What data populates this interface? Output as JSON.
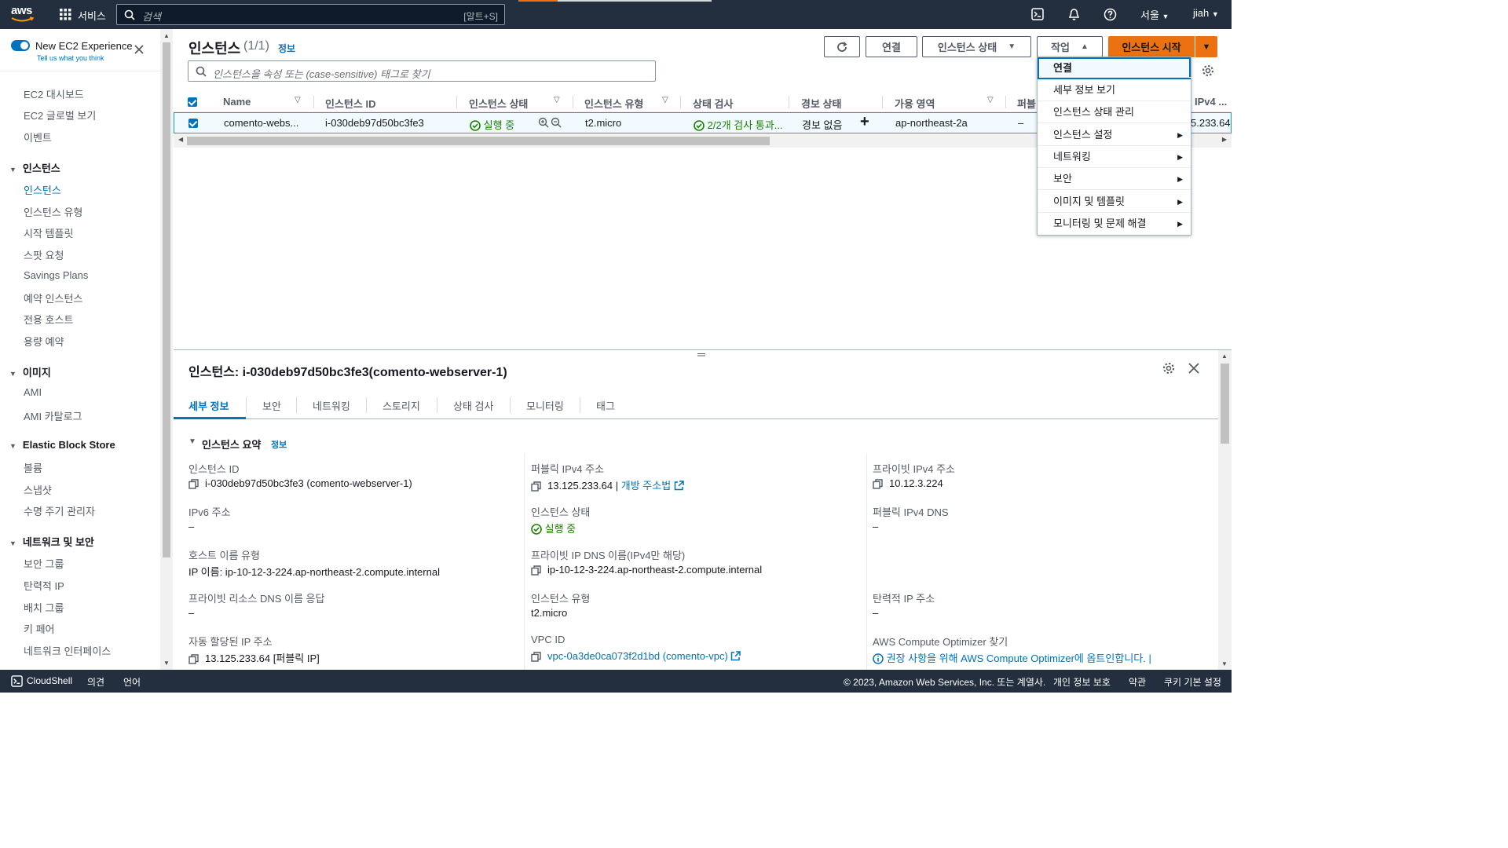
{
  "topnav": {
    "logo": "aws",
    "services": "서비스",
    "search_placeholder": "검색",
    "search_shortcut": "[알트+S]",
    "region": "서울",
    "user": "jiah",
    "icons": [
      "cloudshell-icon",
      "bell-icon",
      "help-icon"
    ]
  },
  "sidebar": {
    "experience_title": "New EC2 Experience",
    "experience_sub": "Tell us what you think",
    "top_items": [
      "EC2 대시보드",
      "EC2 글로벌 보기",
      "이벤트"
    ],
    "sections": [
      {
        "title": "인스턴스",
        "items": [
          "인스턴스",
          "인스턴스 유형",
          "시작 템플릿",
          "스팟 요청",
          "Savings Plans",
          "예약 인스턴스",
          "전용 호스트",
          "용량 예약"
        ]
      },
      {
        "title": "이미지",
        "items": [
          "AMI",
          "AMI 카탈로그"
        ]
      },
      {
        "title": "Elastic Block Store",
        "items": [
          "볼륨",
          "스냅샷",
          "수명 주기 관리자"
        ]
      },
      {
        "title": "네트워크 및 보안",
        "items": [
          "보안 그룹",
          "탄력적 IP",
          "배치 그룹",
          "키 페어",
          "네트워크 인터페이스"
        ]
      }
    ]
  },
  "header": {
    "title": "인스턴스",
    "count": "(1/1)",
    "info": "정보",
    "buttons": {
      "connect": "연결",
      "instance_state": "인스턴스 상태",
      "actions": "작업",
      "launch": "인스턴스 시작"
    },
    "filter_placeholder": "인스턴스을 속성 또는 (case-sensitive) 태그로 찾기"
  },
  "table": {
    "columns": [
      "Name",
      "인스턴스 ID",
      "인스턴스 상태",
      "인스턴스 유형",
      "상태 검사",
      "경보 상태",
      "가용 영역",
      "퍼블",
      "IPv4 ..."
    ],
    "row": {
      "name": "comento-webs...",
      "id": "i-030deb97d50bc3fe3",
      "state": "실행 중",
      "type": "t2.micro",
      "check": "2/2개 검사 통과...",
      "alarm": "경보 없음",
      "add": "+",
      "az": "ap-northeast-2a",
      "public": "–",
      "ipv4": "5.233.64"
    }
  },
  "menu": [
    {
      "label": "연결",
      "sub": false
    },
    {
      "label": "세부 정보 보기",
      "sub": false
    },
    {
      "label": "인스턴스 상태 관리",
      "sub": false
    },
    {
      "label": "인스턴스 설정",
      "sub": true
    },
    {
      "label": "네트워킹",
      "sub": true
    },
    {
      "label": "보안",
      "sub": true
    },
    {
      "label": "이미지 및 템플릿",
      "sub": true
    },
    {
      "label": "모니터링 및 문제 해결",
      "sub": true
    }
  ],
  "detail": {
    "title": "인스턴스: i-030deb97d50bc3fe3(comento-webserver-1)",
    "tabs": [
      "세부 정보",
      "보안",
      "네트워킹",
      "스토리지",
      "상태 검사",
      "모니터링",
      "태그"
    ],
    "summary": "인스턴스 요약",
    "summary_info": "정보",
    "fields": {
      "id_label": "인스턴스 ID",
      "id": "i-030deb97d50bc3fe3 (comento-webserver-1)",
      "pub_ip_label": "퍼블릭 IPv4 주소",
      "pub_ip": "13.125.233.64 |",
      "open_addr": "개방 주소법",
      "priv_ip_label": "프라이빗 IPv4 주소",
      "priv_ip": "10.12.3.224",
      "ipv6_label": "IPv6 주소",
      "ipv6": "–",
      "state_label": "인스턴스 상태",
      "state": "실행 중",
      "pub_dns_label": "퍼블릭 IPv4 DNS",
      "pub_dns": "–",
      "host_type_label": "호스트 이름 유형",
      "host_type": "IP 이름: ip-10-12-3-224.ap-northeast-2.compute.internal",
      "priv_dns_label": "프라이빗 IP DNS 이름(IPv4만 해당)",
      "priv_dns": "ip-10-12-3-224.ap-northeast-2.compute.internal",
      "res_dns_label": "프라이빗 리소스 DNS 이름 응답",
      "res_dns": "–",
      "type_label": "인스턴스 유형",
      "type": "t2.micro",
      "eip_label": "탄력적 IP 주소",
      "eip": "–",
      "auto_ip_label": "자동 할당된 IP 주소",
      "auto_ip": "13.125.233.64 [퍼블릭 IP]",
      "vpc_label": "VPC ID",
      "vpc": "vpc-0a3de0ca073f2d1bd (comento-vpc)",
      "optimizer_label": "AWS Compute Optimizer 찾기",
      "optimizer": "권장 사항을 위해 AWS Compute Optimizer에 옵트인합니다. |"
    }
  },
  "footer": {
    "cloudshell": "CloudShell",
    "feedback": "의견",
    "language": "언어",
    "copyright": "© 2023, Amazon Web Services, Inc. 또는 계열사.",
    "privacy": "개인 정보 보호",
    "terms": "약관",
    "cookies": "쿠키 기본 설정"
  }
}
